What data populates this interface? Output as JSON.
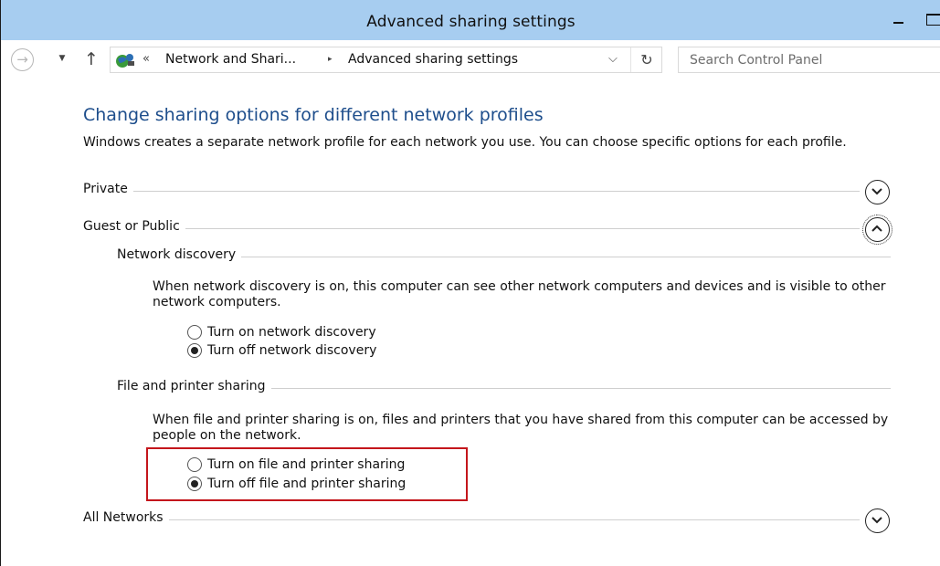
{
  "window": {
    "title": "Advanced sharing settings"
  },
  "addressbar": {
    "back_icon": "arrow-right-circle-icon",
    "breadcrumb_chevron": "«",
    "crumbs": [
      "Network and Shari...",
      "Advanced sharing settings"
    ],
    "separator": "▸",
    "dropdown": "⌵",
    "refresh": "↻"
  },
  "search": {
    "placeholder": "Search Control Panel"
  },
  "main": {
    "heading": "Change sharing options for different network profiles",
    "intro": "Windows creates a separate network profile for each network you use. You can choose specific options for each profile.",
    "profiles": {
      "private": {
        "label": "Private",
        "expanded": false
      },
      "guest_public": {
        "label": "Guest or Public",
        "expanded": true,
        "network_discovery": {
          "label": "Network discovery",
          "description": "When network discovery is on, this computer can see other network computers and devices and is visible to other network computers.",
          "options": [
            "Turn on network discovery",
            "Turn off network discovery"
          ],
          "selected": "Turn off network discovery"
        },
        "file_printer_sharing": {
          "label": "File and printer sharing",
          "description": "When file and printer sharing is on, files and printers that you have shared from this computer can be accessed by people on the network.",
          "options": [
            "Turn on file and printer sharing",
            "Turn off file and printer sharing"
          ],
          "selected": "Turn off file and printer sharing"
        }
      },
      "all_networks": {
        "label": "All Networks",
        "expanded": false
      }
    }
  },
  "colors": {
    "titlebar": "#a7cdf0",
    "heading": "#1e4e8c",
    "highlight": "#c4161c"
  }
}
